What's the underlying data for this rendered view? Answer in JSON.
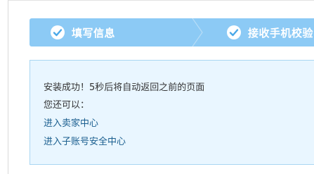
{
  "steps": [
    {
      "label": "填写信息",
      "status": "done"
    },
    {
      "label": "接收手机校验",
      "status": "done"
    }
  ],
  "result": {
    "message": "安装成功！5秒后将自动返回之前的页面",
    "hint": "您还可以：",
    "links": [
      {
        "label": "进入卖家中心"
      },
      {
        "label": "进入子账号安全中心"
      }
    ]
  },
  "colors": {
    "step_bar": "#8ccaf5",
    "panel_bg": "#e9f6ff",
    "panel_border": "#a9d6f2",
    "link": "#1a5e8f"
  }
}
